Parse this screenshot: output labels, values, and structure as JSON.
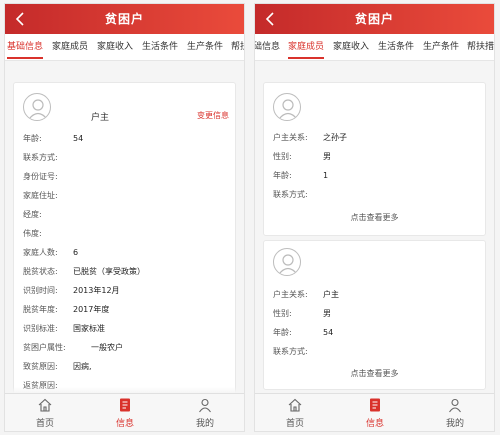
{
  "colors": {
    "primary": "#d9322c",
    "header_start": "#c42a2a",
    "header_end": "#ea4b3b"
  },
  "left": {
    "title": "贫困户",
    "tabs": [
      {
        "label": "基础信息",
        "active": true
      },
      {
        "label": "家庭成员",
        "active": false
      },
      {
        "label": "家庭收入",
        "active": false
      },
      {
        "label": "生活条件",
        "active": false
      },
      {
        "label": "生产条件",
        "active": false
      },
      {
        "label": "帮扶",
        "active": false
      }
    ],
    "card": {
      "role": "户主",
      "change_label": "变更信息",
      "fields": [
        {
          "label": "年龄:",
          "value": "54"
        },
        {
          "label": "联系方式:",
          "value": ""
        },
        {
          "label": "身份证号:",
          "value": ""
        },
        {
          "label": "家庭住址:",
          "value": ""
        },
        {
          "label": "经度:",
          "value": ""
        },
        {
          "label": "伟度:",
          "value": ""
        },
        {
          "label": "家庭人数:",
          "value": "6"
        },
        {
          "label": "脱贫状态:",
          "value": "已脱贫（享受政策）"
        },
        {
          "label": "识别时间:",
          "value": "2013年12月"
        },
        {
          "label": "脱贫年度:",
          "value": "2017年度"
        },
        {
          "label": "识别标准:",
          "value": "国家标准"
        },
        {
          "label": "贫困户属性:",
          "value": "一般农户"
        },
        {
          "label": "致贫原因:",
          "value": "因病,"
        },
        {
          "label": "返贫原因:",
          "value": ""
        }
      ]
    }
  },
  "right": {
    "title": "贫困户",
    "tabs": [
      {
        "label": "础信息",
        "active": false
      },
      {
        "label": "家庭成员",
        "active": true
      },
      {
        "label": "家庭收入",
        "active": false
      },
      {
        "label": "生活条件",
        "active": false
      },
      {
        "label": "生产条件",
        "active": false
      },
      {
        "label": "帮扶措",
        "active": false
      }
    ],
    "members": [
      {
        "fields": [
          {
            "label": "户主关系:",
            "value": "之孙子"
          },
          {
            "label": "性别:",
            "value": "男"
          },
          {
            "label": "年龄:",
            "value": "1"
          },
          {
            "label": "联系方式:",
            "value": ""
          }
        ],
        "more": "点击查看更多"
      },
      {
        "fields": [
          {
            "label": "户主关系:",
            "value": "户主"
          },
          {
            "label": "性别:",
            "value": "男"
          },
          {
            "label": "年龄:",
            "value": "54"
          },
          {
            "label": "联系方式:",
            "value": ""
          }
        ],
        "more": "点击查看更多"
      }
    ]
  },
  "nav": [
    {
      "label": "首页",
      "icon": "home-icon",
      "active": false
    },
    {
      "label": "信息",
      "icon": "info-icon",
      "active": true
    },
    {
      "label": "我的",
      "icon": "user-icon",
      "active": false
    }
  ]
}
